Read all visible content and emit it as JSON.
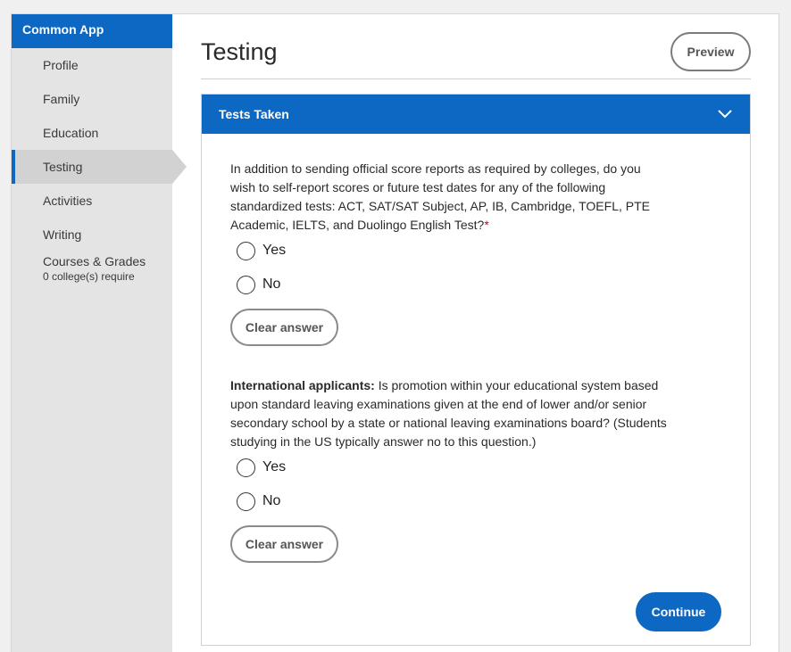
{
  "sidebar": {
    "header": "Common App",
    "items": [
      {
        "label": "Profile"
      },
      {
        "label": "Family"
      },
      {
        "label": "Education"
      },
      {
        "label": "Testing"
      },
      {
        "label": "Activities"
      },
      {
        "label": "Writing"
      },
      {
        "label": "Courses & Grades",
        "sub": "0 college(s) require"
      }
    ],
    "active_index": 3
  },
  "page": {
    "title": "Testing",
    "preview_label": "Preview"
  },
  "section": {
    "title": "Tests Taken",
    "icon": "chevron-down-icon",
    "q1": {
      "text": "In addition to sending official score reports as required by colleges, do you wish to self-report scores or future test dates for any of the following standardized tests: ACT, SAT/SAT Subject, AP, IB, Cambridge, TOEFL, PTE Academic, IELTS, and Duolingo English Test?",
      "required_mark": "*",
      "options": [
        "Yes",
        "No"
      ],
      "clear_label": "Clear answer"
    },
    "q2": {
      "bold_prefix": "International applicants:",
      "text": " Is promotion within your educational system based upon standard leaving examinations given at the end of lower and/or senior secondary school by a state or national leaving examinations board? (Students studying in the US typically answer no to this question.)",
      "options": [
        "Yes",
        "No"
      ],
      "clear_label": "Clear answer"
    },
    "continue_label": "Continue"
  },
  "colors": {
    "accent": "#0c68c3",
    "sidebar_bg": "#e4e4e4",
    "required": "#d0021b"
  }
}
